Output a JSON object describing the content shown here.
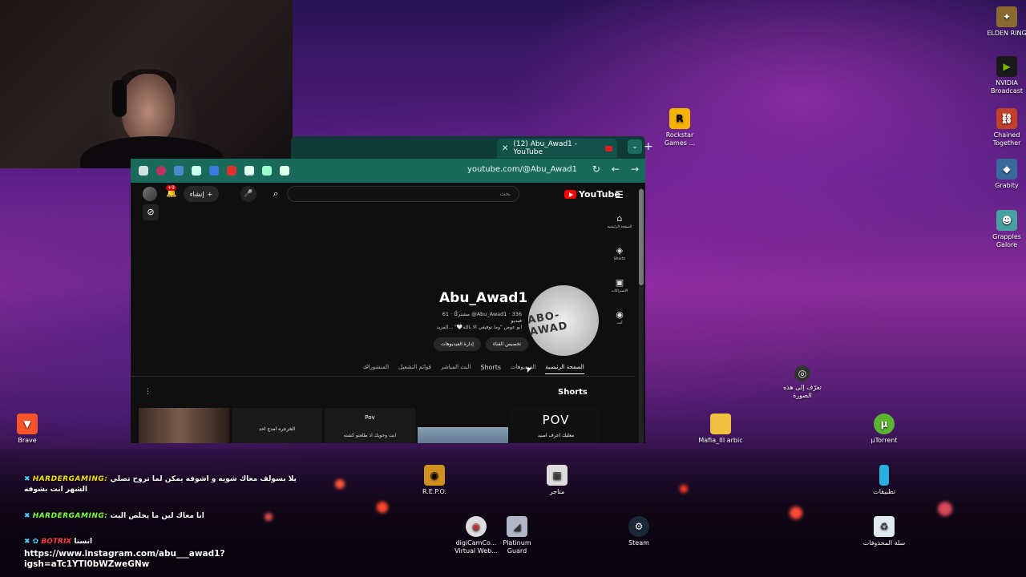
{
  "browser": {
    "tab_title": "(12) Abu_Awad1 - YouTube",
    "new_tab": "+",
    "tab_close": "✕",
    "url": "youtube.com/@Abu_Awad1"
  },
  "youtube": {
    "logo_text": "YouTube",
    "search_placeholder": "بحث",
    "create_label": "إنشاء",
    "notif_count": "+9",
    "side_nav": [
      {
        "icon": "⌂",
        "label": "الصفحة الرئيسية"
      },
      {
        "icon": "◈",
        "label": "Shorts"
      },
      {
        "icon": "▣",
        "label": "الاشتراكات"
      },
      {
        "icon": "◉",
        "label": "أنت"
      }
    ],
    "channel": {
      "avatar_text": "ABO-AWAD",
      "name": "Abu_Awad1",
      "handle_meta": "‎@Abu_Awad1 · 336 مشتركًا · 61 فيديو",
      "description": "ابو عوض \"وما توفيقي الا بالله🤍\" ...المزيد",
      "btn_customize": "تخصيص القناة",
      "btn_manage": "إدارة الفيديوهات"
    },
    "tabs": {
      "home": "الصفحة الرئيسية",
      "videos": "الفيديوهات",
      "shorts": "Shorts",
      "live": "البث المباشر",
      "playlists": "قوائم التشغيل",
      "posts": "المنشورات"
    },
    "shorts_heading": "Shorts",
    "shorts": [
      {
        "top": "",
        "caption": ""
      },
      {
        "top": "",
        "caption": "الخرجره امدح احد"
      },
      {
        "top": "Pov",
        "caption": "انت وخويك اذ طلعتو كشته"
      },
      {
        "top": "",
        "caption": ""
      },
      {
        "top": "POV",
        "caption": "معليك اعرف اصيد"
      }
    ]
  },
  "desktop_icons": {
    "elden_ring": "ELDEN RING",
    "nvidia_broadcast": "NVIDIA Broadcast",
    "rockstar": "Rockstar Games ...",
    "chained_together": "Chained Together",
    "grabity": "Grabity",
    "grapples": "Grapples Galore",
    "learn_picture": "تعرّف إلى هذه الصورة",
    "brave": "Brave",
    "mafia": "Mafia_III arbic",
    "utorrent": "µTorrent",
    "repo": "R.E.P.O.",
    "stores": "متاجر",
    "apps": "تطبيقات",
    "digicam": "digiCamCo... Virtual Web...",
    "platinum": "Platinum Guard",
    "steam": "Steam",
    "recycle": "سلة المحذوفات"
  },
  "chat": [
    {
      "user": "HARDERGAMING:",
      "message": "يلا بسولف معاك شويه و اشوفه يمكن لما تروح تصلي",
      "message2": "الشهر انت بشوفه"
    },
    {
      "user": "HARDERGAMING:",
      "message": "انا معاك لين ما يخلص البث"
    },
    {
      "user": "BOTRIX",
      "message": "انستا"
    }
  ],
  "chat_link": {
    "line1": "https://www.instagram.com/abu___awad1?",
    "line2": "igsh=aTc1YTl0bWZweGNw"
  }
}
